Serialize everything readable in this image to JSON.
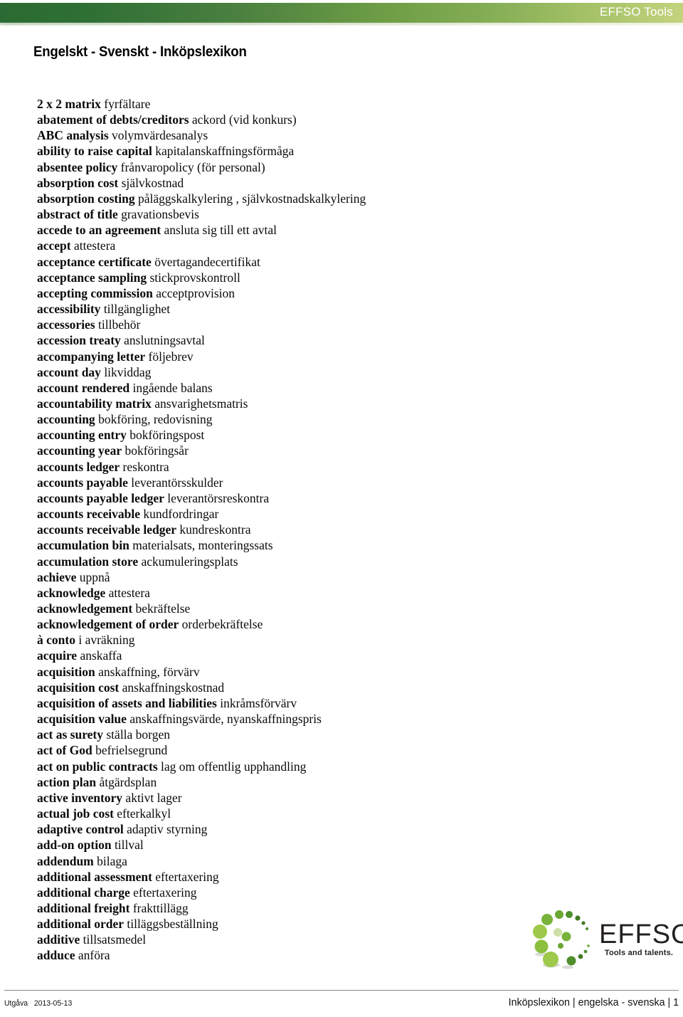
{
  "header": {
    "brand": "EFFSO Tools",
    "gradient_from": "#2b6b33",
    "gradient_to": "#c3d37e"
  },
  "page_title": "Engelskt - Svenskt - Inköpslexikon",
  "glossary": {
    "entries": [
      {
        "term": "2 x 2 matrix",
        "def": "fyrfältare"
      },
      {
        "term": "abatement of debts/creditors",
        "def": "ackord (vid konkurs)"
      },
      {
        "term": "ABC analysis",
        "def": "volymvärdesanalys"
      },
      {
        "term": "ability to raise capital",
        "def": "kapitalanskaffningsförmåga"
      },
      {
        "term": "absentee policy",
        "def": "frånvaropolicy (för personal)"
      },
      {
        "term": "absorption cost",
        "def": "självkostnad"
      },
      {
        "term": "absorption costing",
        "def": "påläggskalkylering , självkostnadskalkylering"
      },
      {
        "term": "abstract of title",
        "def": "gravationsbevis"
      },
      {
        "term": "accede to an agreement",
        "def": "ansluta sig till ett avtal"
      },
      {
        "term": "accept",
        "def": "attestera"
      },
      {
        "term": "acceptance certificate",
        "def": "övertagandecertifikat"
      },
      {
        "term": "acceptance sampling",
        "def": "stickprovskontroll"
      },
      {
        "term": "accepting commission",
        "def": "acceptprovision"
      },
      {
        "term": "accessibility",
        "def": "tillgänglighet"
      },
      {
        "term": "accessories",
        "def": "tillbehör"
      },
      {
        "term": "accession treaty",
        "def": "anslutningsavtal"
      },
      {
        "term": "accompanying letter",
        "def": "följebrev"
      },
      {
        "term": "account day",
        "def": "likviddag"
      },
      {
        "term": "account rendered",
        "def": "ingående balans"
      },
      {
        "term": "accountability matrix",
        "def": "ansvarighetsmatris"
      },
      {
        "term": "accounting",
        "def": "bokföring, redovisning"
      },
      {
        "term": "accounting entry",
        "def": "bokföringspost"
      },
      {
        "term": "accounting year",
        "def": "bokföringsår"
      },
      {
        "term": "accounts ledger",
        "def": "reskontra"
      },
      {
        "term": "accounts payable",
        "def": "leverantörsskulder"
      },
      {
        "term": "accounts payable ledger",
        "def": "leverantörsreskontra"
      },
      {
        "term": "accounts receivable",
        "def": "kundfordringar"
      },
      {
        "term": "accounts receivable ledger",
        "def": "kundreskontra"
      },
      {
        "term": "accumulation bin",
        "def": "materialsats, monteringssats"
      },
      {
        "term": "accumulation store",
        "def": "ackumuleringsplats"
      },
      {
        "term": "achieve",
        "def": "uppnå"
      },
      {
        "term": "acknowledge",
        "def": "attestera"
      },
      {
        "term": "acknowledgement",
        "def": "bekräftelse"
      },
      {
        "term": "acknowledgement of order",
        "def": "orderbekräftelse"
      },
      {
        "term": "à conto",
        "def": "i avräkning"
      },
      {
        "term": "acquire",
        "def": "anskaffa"
      },
      {
        "term": "acquisition",
        "def": "anskaffning, förvärv"
      },
      {
        "term": "acquisition cost",
        "def": "anskaffningskostnad"
      },
      {
        "term": "acquisition of assets and liabilities",
        "def": "inkråmsförvärv"
      },
      {
        "term": "acquisition value",
        "def": "anskaffningsvärde, nyanskaffningspris"
      },
      {
        "term": "act as surety",
        "def": "ställa borgen"
      },
      {
        "term": "act of God",
        "def": "befrielsegrund"
      },
      {
        "term": "act on public contracts",
        "def": "lag om offentlig upphandling"
      },
      {
        "term": "action plan",
        "def": "åtgärdsplan"
      },
      {
        "term": "active inventory",
        "def": "aktivt lager"
      },
      {
        "term": "actual job cost",
        "def": "efterkalkyl"
      },
      {
        "term": "adaptive control",
        "def": "adaptiv styrning"
      },
      {
        "term": "add-on option",
        "def": "tillval"
      },
      {
        "term": "addendum",
        "def": "bilaga"
      },
      {
        "term": "additional assessment",
        "def": "eftertaxering"
      },
      {
        "term": "additional charge",
        "def": "eftertaxering"
      },
      {
        "term": "additional freight",
        "def": "frakttillägg"
      },
      {
        "term": "additional order",
        "def": "tilläggsbeställning"
      },
      {
        "term": "additive",
        "def": "tillsatsmedel"
      },
      {
        "term": "adduce",
        "def": "anföra"
      }
    ]
  },
  "logo": {
    "wordmark": "EFFSO",
    "registered_mark": "®",
    "tagline": "Tools and talents.",
    "dot_colors": [
      "#8cbf3f",
      "#a6cc5a",
      "#6aa832",
      "#4e8f2c",
      "#3f7a25",
      "#b7d678"
    ]
  },
  "footer": {
    "edition_label": "Utgåva",
    "edition_date": "2013-05-13",
    "right_text": "Inköpslexikon | engelska - svenska | 1"
  }
}
